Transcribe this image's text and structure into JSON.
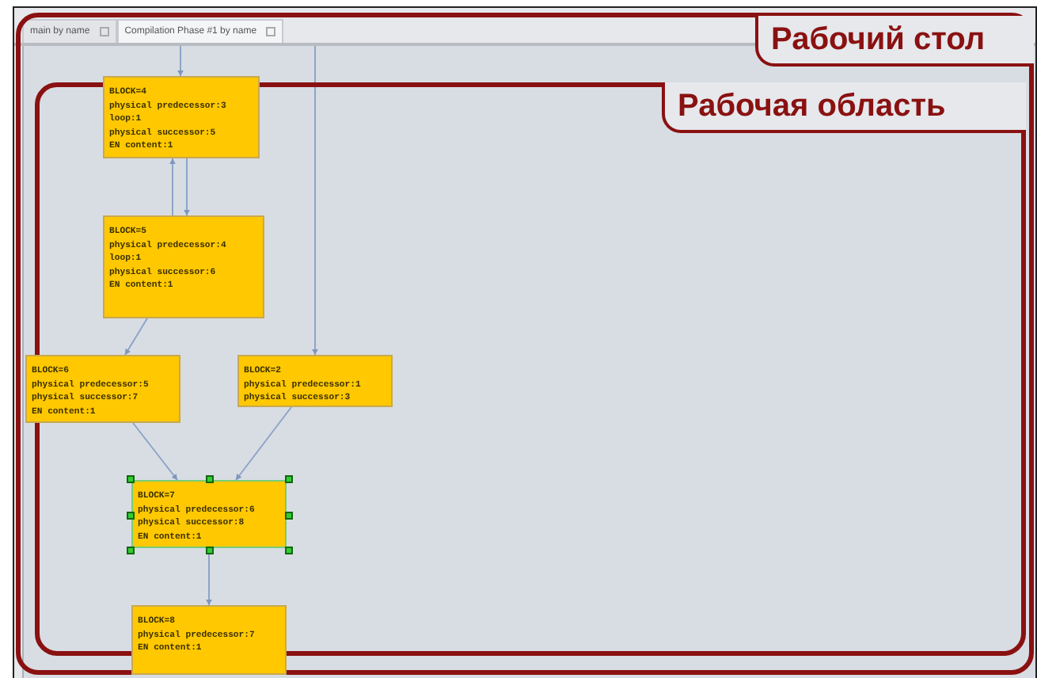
{
  "tabs": [
    {
      "label": "main by name",
      "selected": false
    },
    {
      "label": "Compilation Phase #1 by name",
      "selected": true
    }
  ],
  "graph": {
    "nodes": [
      {
        "lines": [
          "BLOCK=4",
          "physical predecessor:3",
          "loop:1",
          "physical successor:5",
          "EN content:1"
        ],
        "selected": false
      },
      {
        "lines": [
          "BLOCK=5",
          "physical predecessor:4",
          "loop:1",
          "physical successor:6",
          "EN content:1"
        ],
        "selected": false
      },
      {
        "lines": [
          "BLOCK=6",
          "physical predecessor:5",
          "physical successor:7",
          "EN content:1"
        ],
        "selected": false
      },
      {
        "lines": [
          "BLOCK=2",
          "physical predecessor:1",
          "physical successor:3"
        ],
        "selected": false
      },
      {
        "lines": [
          "BLOCK=7",
          "physical predecessor:6",
          "physical successor:8",
          "EN content:1"
        ],
        "selected": true
      },
      {
        "lines": [
          "BLOCK=8",
          "physical predecessor:7",
          "EN content:1"
        ],
        "selected": false
      }
    ]
  },
  "annotations": [
    {
      "label": "Рабочий стол"
    },
    {
      "label": "Рабочая область"
    }
  ]
}
